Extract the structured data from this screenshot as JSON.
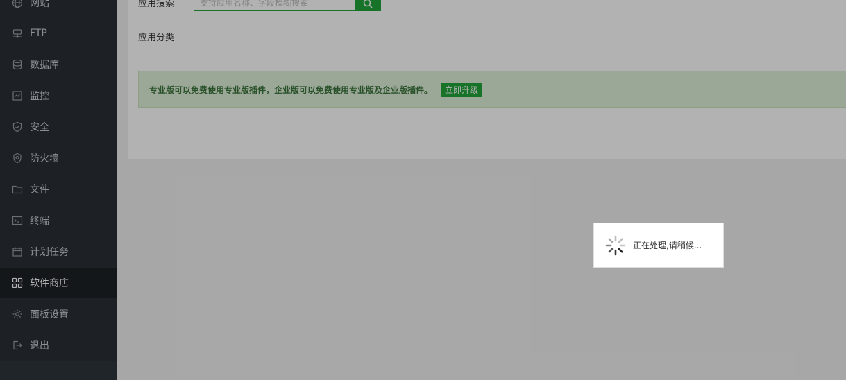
{
  "sidebar": {
    "items": [
      {
        "label": "网站",
        "icon": "globe-icon"
      },
      {
        "label": "FTP",
        "icon": "ftp-icon"
      },
      {
        "label": "数据库",
        "icon": "database-icon"
      },
      {
        "label": "监控",
        "icon": "monitor-icon"
      },
      {
        "label": "安全",
        "icon": "shield-icon"
      },
      {
        "label": "防火墙",
        "icon": "firewall-icon"
      },
      {
        "label": "文件",
        "icon": "folder-icon"
      },
      {
        "label": "终端",
        "icon": "terminal-icon"
      },
      {
        "label": "计划任务",
        "icon": "calendar-icon"
      },
      {
        "label": "软件商店",
        "icon": "grid-icon",
        "active": true
      },
      {
        "label": "面板设置",
        "icon": "gear-icon"
      },
      {
        "label": "退出",
        "icon": "logout-icon"
      }
    ]
  },
  "main": {
    "search_label": "应用搜索",
    "search_placeholder": "支持应用名称、字段模糊搜索",
    "category_label": "应用分类",
    "notice_text": "专业版可以免费使用专业版插件，企业版可以免费使用专业版及企业版插件。",
    "upgrade_label": "立即升级"
  },
  "loading": {
    "text": "正在处理,请稍候..."
  },
  "colors": {
    "accent": "#20a53a",
    "sidebar_bg": "#2a2f35",
    "notice_bg": "#dff0d8",
    "notice_text": "#3c763d"
  }
}
